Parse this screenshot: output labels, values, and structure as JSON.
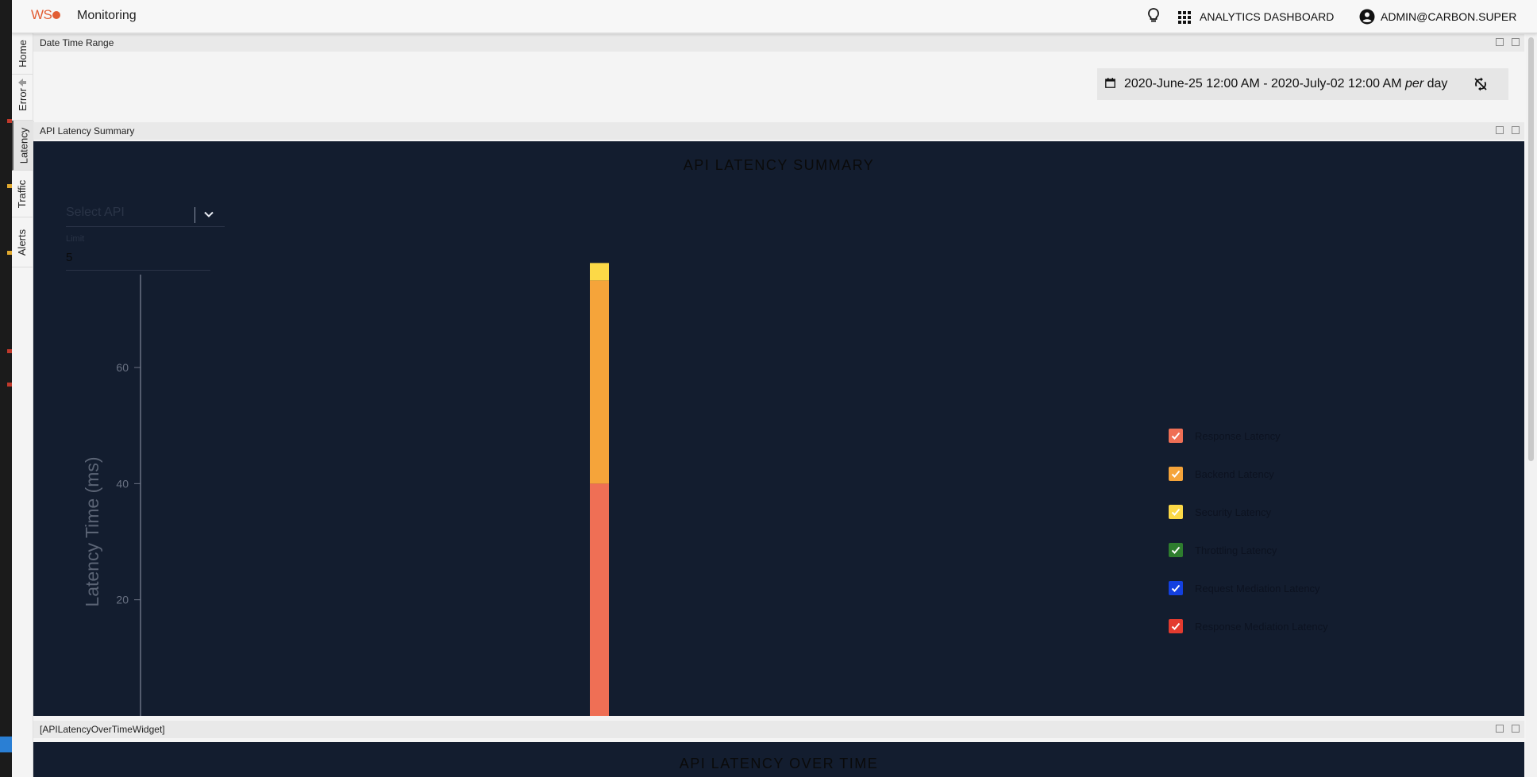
{
  "header": {
    "logo_text": "WS",
    "app_title": "Monitoring",
    "dashboard_label": "ANALYTICS DASHBOARD",
    "user_label": "ADMIN@CARBON.SUPER"
  },
  "sidebar": {
    "tabs": [
      {
        "label": "Home"
      },
      {
        "label": "Error"
      },
      {
        "label": "Latency",
        "active": true
      },
      {
        "label": "Traffic"
      },
      {
        "label": "Alerts"
      }
    ]
  },
  "date_widget": {
    "title": "Date Time Range",
    "range_text": "2020-June-25 12:00 AM - 2020-July-02 12:00 AM",
    "per_label": "per",
    "granularity": "day"
  },
  "latency_widget": {
    "header_title": "API Latency Summary",
    "title": "API LATENCY SUMMARY",
    "select_placeholder": "Select API",
    "limit_label": "Limit",
    "limit_value": "5"
  },
  "overtime_widget": {
    "header_title": "[APILatencyOverTimeWidget]",
    "title": "API LATENCY OVER TIME"
  },
  "chart_data": {
    "type": "bar",
    "stacked": true,
    "title": "",
    "xlabel": "",
    "ylabel": "Latency Time (ms)",
    "yticks": [
      20,
      40,
      60
    ],
    "ylim": [
      0,
      76
    ],
    "categories": [
      ""
    ],
    "series": [
      {
        "name": "Response Latency",
        "color": "#ef6f55",
        "values": [
          40
        ]
      },
      {
        "name": "Backend Latency",
        "color": "#f5a43a",
        "values": [
          35
        ]
      },
      {
        "name": "Security Latency",
        "color": "#fcd947",
        "values": [
          3
        ]
      },
      {
        "name": "Throttling Latency",
        "color": "#2e7d2e",
        "values": [
          0
        ]
      },
      {
        "name": "Request Mediation Latency",
        "color": "#1340e0",
        "values": [
          0
        ]
      },
      {
        "name": "Response Mediation Latency",
        "color": "#e33b2f",
        "values": [
          0
        ]
      }
    ],
    "legend_position": "right"
  },
  "colors": {
    "accent": "#e25d33",
    "panel_dark": "#131d2f"
  }
}
